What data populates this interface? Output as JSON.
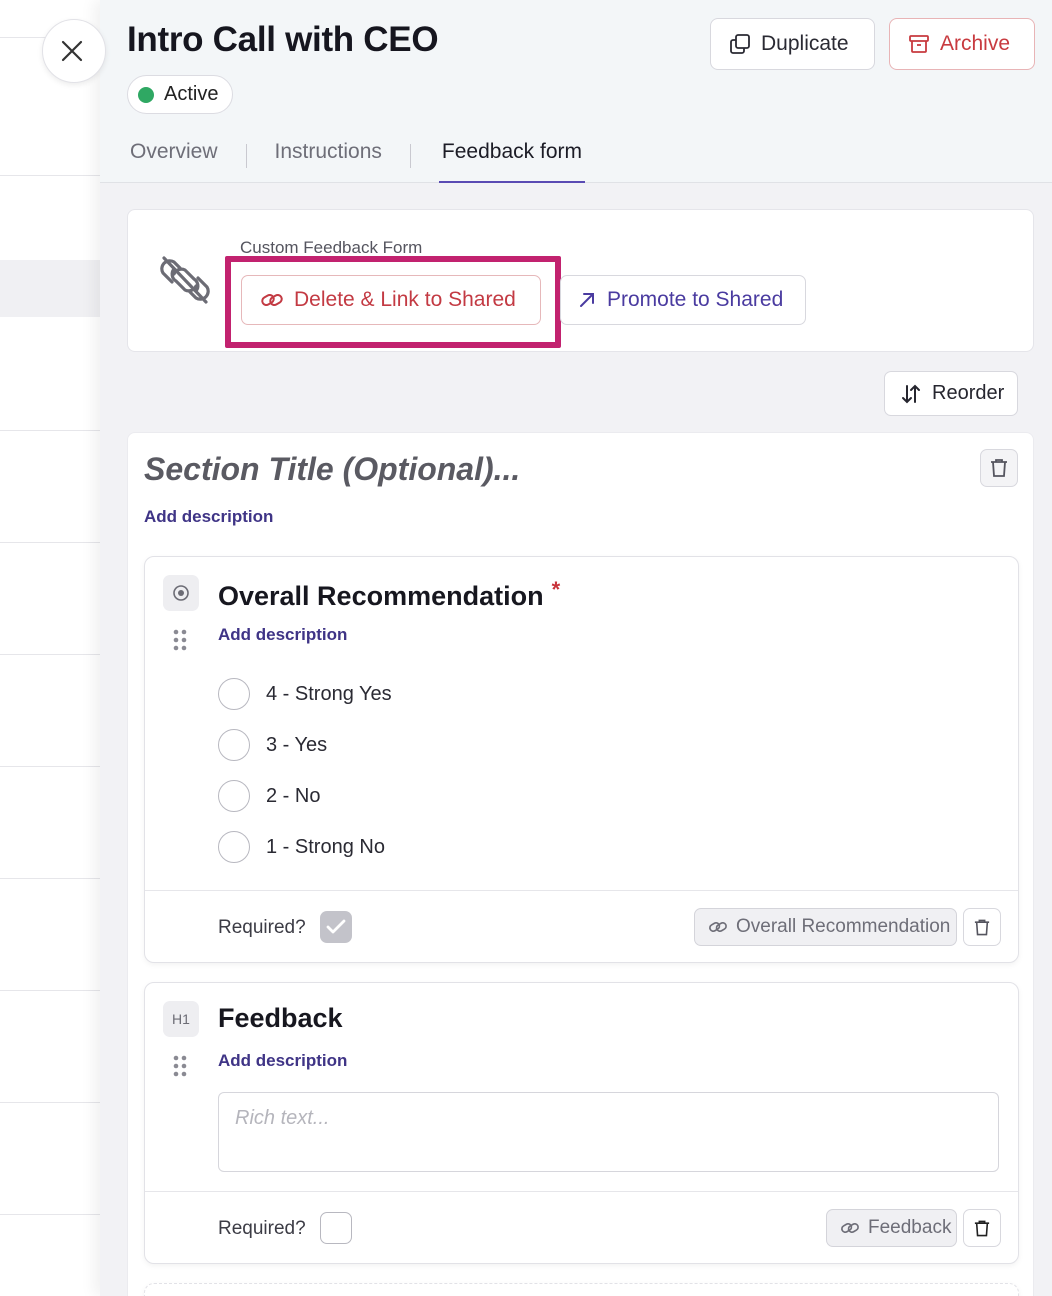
{
  "header": {
    "title": "Intro Call with CEO",
    "status": "Active",
    "duplicate_label": "Duplicate",
    "archive_label": "Archive"
  },
  "tabs": [
    {
      "label": "Overview"
    },
    {
      "label": "Instructions"
    },
    {
      "label": "Feedback form",
      "active": true
    }
  ],
  "custom_form": {
    "label": "Custom Feedback Form",
    "delete_link_label": "Delete & Link to Shared",
    "promote_label": "Promote to Shared"
  },
  "reorder_label": "Reorder",
  "section": {
    "title_placeholder": "Section Title (Optional)...",
    "add_description": "Add description"
  },
  "questions": [
    {
      "type_icon": "radio-icon",
      "title": "Overall Recommendation",
      "required_mark": "*",
      "add_description": "Add description",
      "options": [
        "4 - Strong Yes",
        "3 - Yes",
        "2 - No",
        "1 - Strong No"
      ],
      "required_label": "Required?",
      "required": true,
      "link_label": "Overall Recommendation"
    },
    {
      "type_icon": "H1",
      "title": "Feedback",
      "add_description": "Add description",
      "rich_text_placeholder": "Rich text...",
      "required_label": "Required?",
      "required": false,
      "link_label": "Feedback"
    }
  ],
  "colors": {
    "accent": "#4a3ba0",
    "danger": "#c33a43",
    "highlight": "#c2226f",
    "status_active": "#2fa863"
  }
}
